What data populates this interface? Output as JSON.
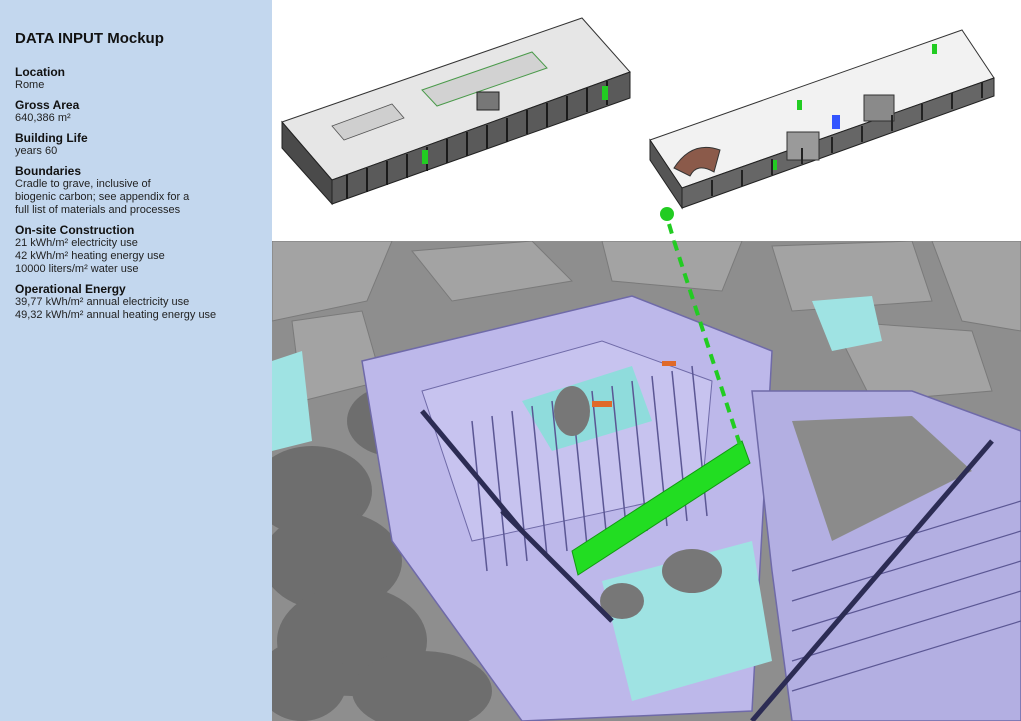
{
  "title": "DATA INPUT Mockup",
  "fields": [
    {
      "label": "Location",
      "lines": [
        "Rome"
      ]
    },
    {
      "label": "Gross Area",
      "lines": [
        "640,386 m²"
      ]
    },
    {
      "label": "Building Life",
      "lines": [
        "years 60"
      ]
    },
    {
      "label": "Boundaries",
      "lines": [
        "Cradle to grave, inclusive of",
        "biogenic carbon; see appendix for a",
        "full list of materials and processes"
      ]
    },
    {
      "label": "On-site Construction",
      "lines": [
        "21 kWh/m² electricity use",
        "42 kWh/m² heating energy use",
        "10000 liters/m² water use"
      ]
    },
    {
      "label": "Operational Energy",
      "lines": [
        "39,77 kWh/m² annual electricity use",
        "49,32 kWh/m² annual heating energy use"
      ]
    }
  ],
  "colors": {
    "sidebar": "#c3d7ee",
    "highlight": "#22dd22",
    "connector": "#22cc22",
    "glazing": "#b9b5e8",
    "ground_water": "#9fe3e3"
  }
}
